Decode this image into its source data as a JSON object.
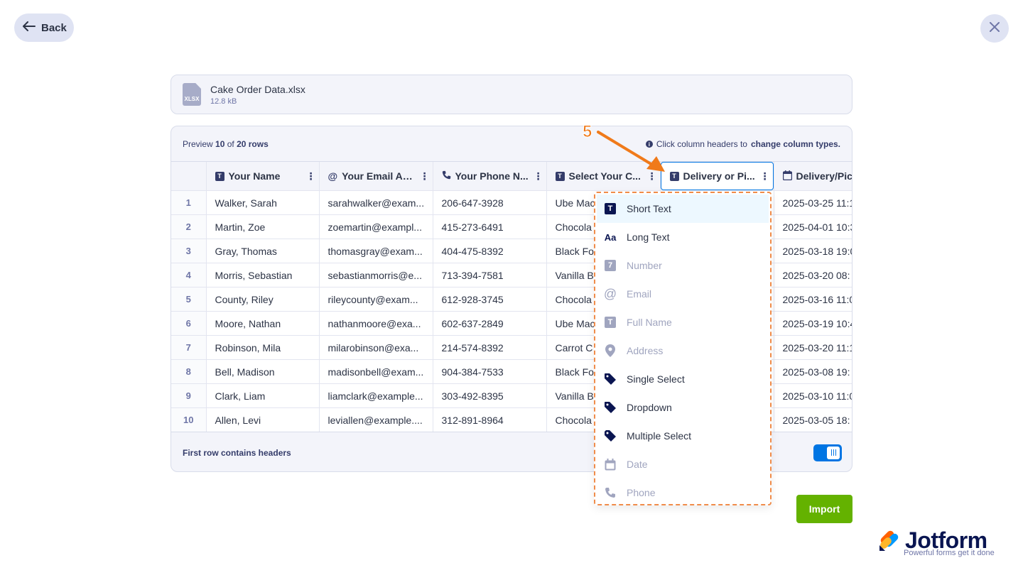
{
  "nav": {
    "back_label": "Back"
  },
  "file": {
    "name": "Cake Order Data.xlsx",
    "size": "12.8 kB",
    "ext": "XLSX"
  },
  "preview": {
    "prefix": "Preview ",
    "shown": "10",
    "of": " of ",
    "total": "20 rows",
    "hint_prefix": "Click column headers to ",
    "hint_bold": "change column types."
  },
  "columns": [
    {
      "icon": "T",
      "label": "Your Name"
    },
    {
      "icon": "@",
      "label": "Your Email Ad..."
    },
    {
      "icon": "phone",
      "label": "Your Phone N..."
    },
    {
      "icon": "T",
      "label": "Select Your C..."
    },
    {
      "icon": "T",
      "label": "Delivery or Pi..."
    },
    {
      "icon": "calendar",
      "label": "Delivery/Pic"
    }
  ],
  "rows": [
    [
      "1",
      "Walker, Sarah",
      "sarahwalker@exam...",
      "206-647-3928",
      "Ube Mac",
      "2025-03-25 11:1"
    ],
    [
      "2",
      "Martin, Zoe",
      "zoemartin@exampl...",
      "415-273-6491",
      "Chocola",
      "2025-04-01 10:3"
    ],
    [
      "3",
      "Gray, Thomas",
      "thomasgray@exam...",
      "404-475-8392",
      "Black Fo",
      "2025-03-18 19:0"
    ],
    [
      "4",
      "Morris, Sebastian",
      "sebastianmorris@e...",
      "713-394-7581",
      "Vanilla B",
      "2025-03-20 08:"
    ],
    [
      "5",
      "County, Riley",
      "rileycounty@exam...",
      "612-928-3745",
      "Chocola",
      "2025-03-16 11:0"
    ],
    [
      "6",
      "Moore, Nathan",
      "nathanmoore@exa...",
      "602-637-2849",
      "Ube Mac",
      "2025-03-19 10:4"
    ],
    [
      "7",
      "Robinson, Mila",
      "milarobinson@exa...",
      "214-574-8392",
      "Carrot C",
      "2025-03-20 11:1"
    ],
    [
      "8",
      "Bell, Madison",
      "madisonbell@exam...",
      "904-384-7533",
      "Black Fo",
      "2025-03-08 19:"
    ],
    [
      "9",
      "Clark, Liam",
      "liamclark@example...",
      "303-492-8395",
      "Vanilla B",
      "2025-03-10 11:0"
    ],
    [
      "10",
      "Allen, Levi",
      "leviallen@example....",
      "312-891-8964",
      "Chocola",
      "2025-03-05 18:"
    ]
  ],
  "footer": {
    "first_row_label": "First row contains headers",
    "first_row_toggle": true
  },
  "import_label": "Import",
  "dropdown": [
    {
      "label": "Short Text",
      "icon": "short-text-icon",
      "state": "selected"
    },
    {
      "label": "Long Text",
      "icon": "long-text-icon",
      "state": "enabled"
    },
    {
      "label": "Number",
      "icon": "number-icon",
      "state": "disabled"
    },
    {
      "label": "Email",
      "icon": "email-icon",
      "state": "disabled"
    },
    {
      "label": "Full Name",
      "icon": "full-name-icon",
      "state": "disabled"
    },
    {
      "label": "Address",
      "icon": "location-pin-icon",
      "state": "disabled"
    },
    {
      "label": "Single Select",
      "icon": "tag-icon",
      "state": "enabled"
    },
    {
      "label": "Dropdown",
      "icon": "tag-icon",
      "state": "enabled"
    },
    {
      "label": "Multiple Select",
      "icon": "tags-icon",
      "state": "enabled"
    },
    {
      "label": "Date",
      "icon": "calendar-icon",
      "state": "disabled"
    },
    {
      "label": "Phone",
      "icon": "phone-icon",
      "state": "disabled"
    }
  ],
  "annotation": {
    "step": "5",
    "color": "#f07a1a"
  },
  "brand": {
    "name": "Jotform",
    "tagline": "Powerful forms get it done"
  },
  "colors": {
    "accent": "#0075e3",
    "import": "#64b200",
    "navy": "#0a1551"
  }
}
